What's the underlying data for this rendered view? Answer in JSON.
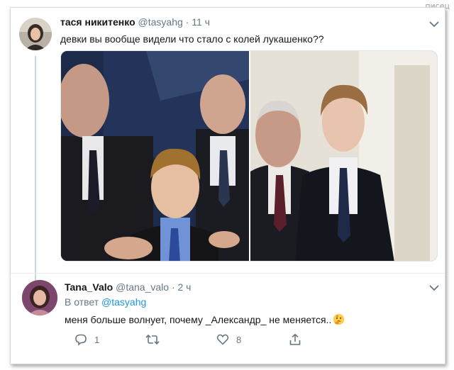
{
  "site_watermark": "писец",
  "tweet": {
    "author_name": "тася никитенко",
    "handle": "@tasyahg",
    "separator": "·",
    "time": "11 ч",
    "text": "девки вы вообще видели что стало с колей лукашенко??",
    "media": {
      "photo_count": 2
    }
  },
  "reply": {
    "author_name": "Tana_Valo",
    "handle": "@tana_valo",
    "separator": "·",
    "time": "2 ч",
    "reply_prefix": "В ответ",
    "reply_to": "@tasyahg",
    "text": "меня больше волнует, почему _Александр_ не меняется..",
    "emoji": "thinking-face",
    "actions": {
      "reply_count": "1",
      "retweet_count": "",
      "like_count": "8"
    }
  },
  "colors": {
    "link": "#1b95e0",
    "muted": "#657786",
    "text": "#14171a",
    "thread_line": "#ccd6dd"
  }
}
